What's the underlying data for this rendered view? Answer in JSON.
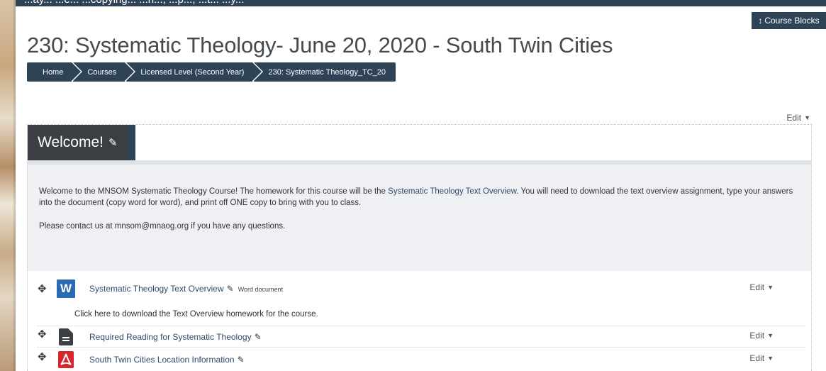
{
  "banner": {
    "text": "...ay... ...e... ...copying... ...n..., ...p..., ...t... ...y..."
  },
  "course_blocks": {
    "label": "Course Blocks"
  },
  "page": {
    "title": "230: Systematic Theology- June 20, 2020 - South Twin Cities"
  },
  "breadcrumb": {
    "items": [
      {
        "label": "Home"
      },
      {
        "label": "Courses"
      },
      {
        "label": "Licensed Level (Second Year)"
      },
      {
        "label": "230: Systematic Theology_TC_20"
      }
    ]
  },
  "top_edit": {
    "label": "Edit"
  },
  "section": {
    "title": "Welcome!",
    "summary": {
      "p1_before": "Welcome to the MNSOM Systematic Theology Course! The homework for this course will be the ",
      "p1_link": "Systematic Theology Text Overview",
      "p1_after": ". You will need to download the text overview assignment, type your answers into the document (copy word for word), and print off ONE copy to bring with you to class.",
      "p2": "Please contact us at mnsom@mnaog.org if you have any questions."
    }
  },
  "activities": [
    {
      "icon": "word-icon",
      "icon_letter": "W",
      "title": "Systematic Theology Text Overview",
      "type": "Word document",
      "description": "Click here to download the Text Overview homework for the course.",
      "edit_label": "Edit"
    },
    {
      "icon": "document-icon",
      "title": "Required Reading for Systematic Theology",
      "edit_label": "Edit"
    },
    {
      "icon": "pdf-icon",
      "title": "South Twin Cities Location Information",
      "edit_label": "Edit"
    }
  ],
  "colors": {
    "navy": "#2f4356",
    "section_title_bg": "#3b3f43",
    "summary_bg": "#eef0f3",
    "link": "#2f4a6e",
    "word_blue": "#2b6bb3",
    "pdf_red": "#d7262b"
  }
}
